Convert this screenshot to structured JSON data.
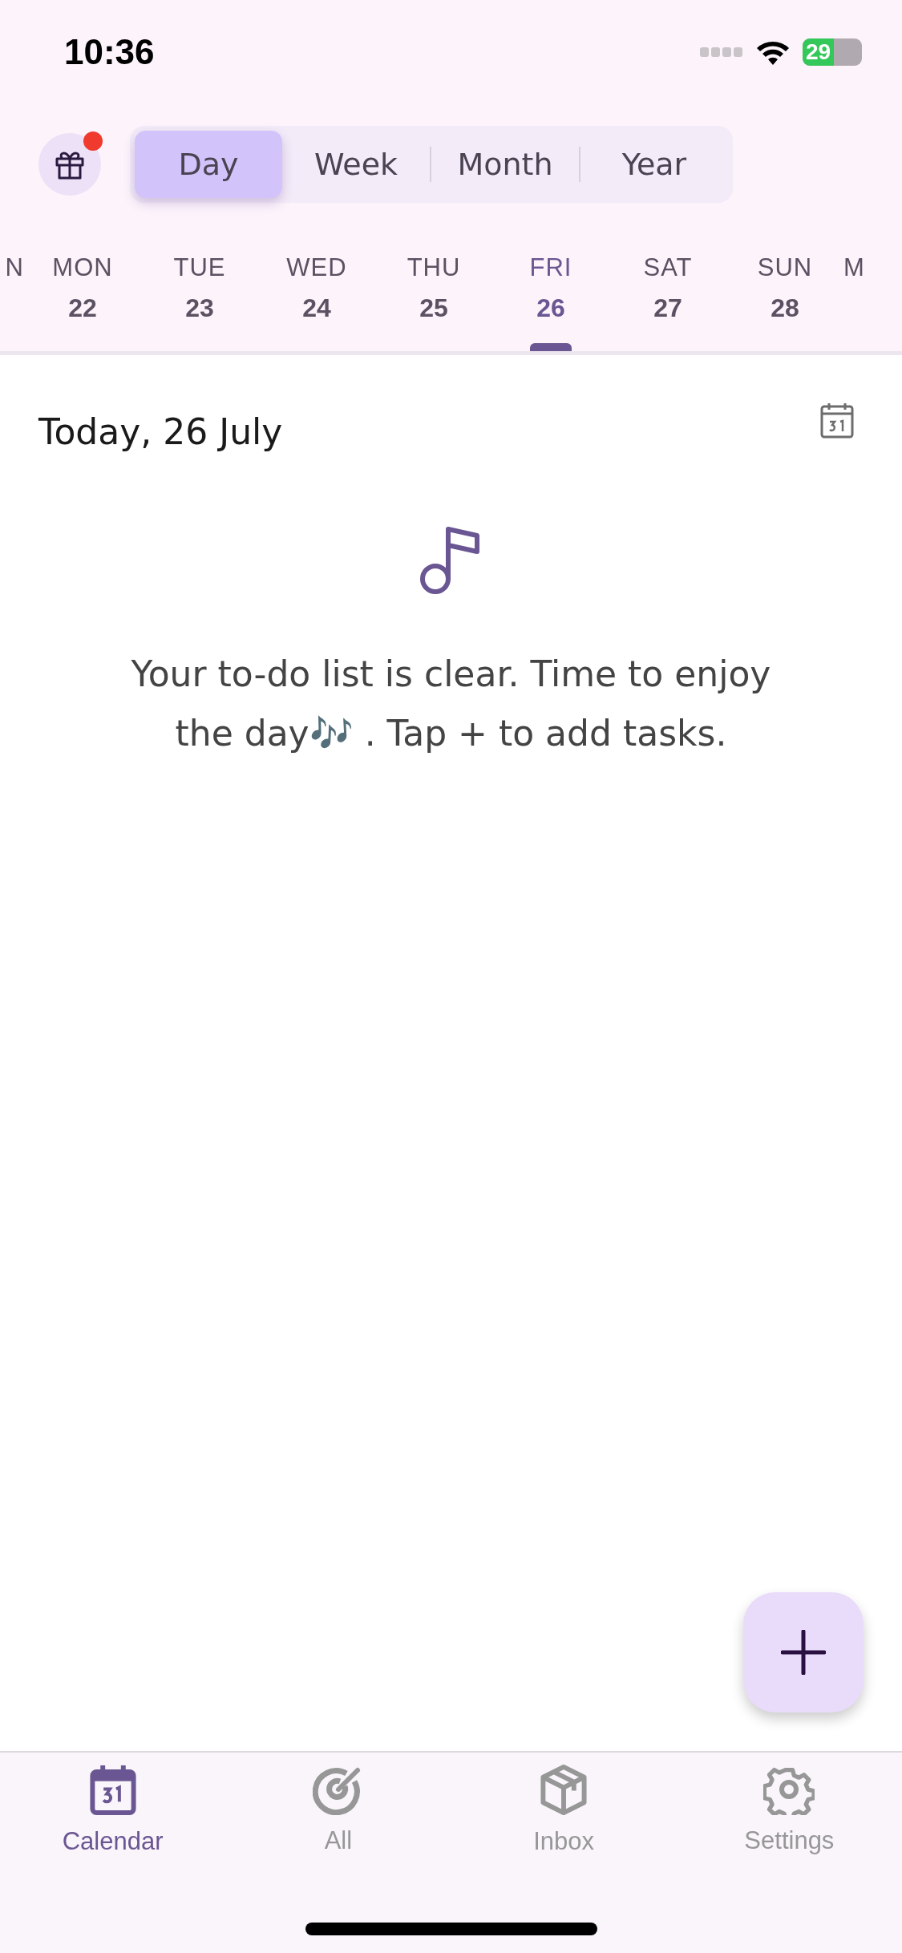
{
  "status_bar": {
    "time": "10:36",
    "battery": "29"
  },
  "view_switcher": {
    "tabs": [
      {
        "label": "Day",
        "selected": true
      },
      {
        "label": "Week",
        "selected": false
      },
      {
        "label": "Month",
        "selected": false
      },
      {
        "label": "Year",
        "selected": false
      }
    ]
  },
  "gift_button": {
    "badge": true
  },
  "days": [
    {
      "label": "N",
      "selected": false
    },
    {
      "label": "MON",
      "number": "22",
      "selected": false
    },
    {
      "label": "TUE",
      "number": "23",
      "selected": false
    },
    {
      "label": "WED",
      "number": "24",
      "selected": false
    },
    {
      "label": "THU",
      "number": "25",
      "selected": false
    },
    {
      "label": "FRI",
      "number": "26",
      "selected": true
    },
    {
      "label": "SAT",
      "number": "27",
      "selected": false
    },
    {
      "label": "SUN",
      "number": "28",
      "selected": false
    },
    {
      "label": "M",
      "selected": false
    }
  ],
  "date_heading": "Today, 26 July",
  "empty_message": "Your to-do list is clear. Time to enjoy the day🎶 . Tap + to add tasks.",
  "tab_bar": [
    {
      "label": "Calendar",
      "kind": "calendar",
      "selected": true
    },
    {
      "label": "All",
      "kind": "target",
      "selected": false
    },
    {
      "label": "Inbox",
      "kind": "box",
      "selected": false
    },
    {
      "label": "Settings",
      "kind": "gear",
      "selected": false
    }
  ]
}
